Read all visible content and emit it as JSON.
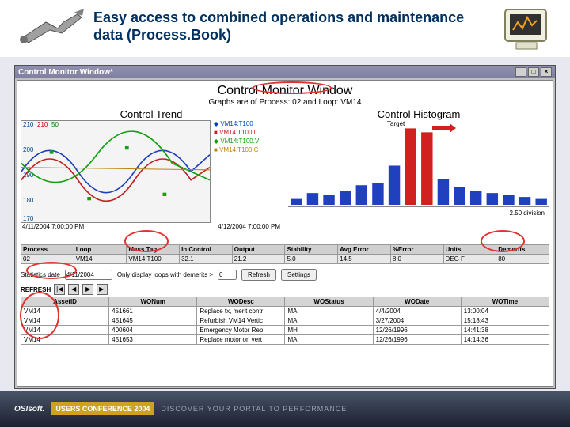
{
  "slide": {
    "title": "Easy access to combined operations and maintenance data (Process.Book)"
  },
  "window": {
    "titlebar": "Control Monitor Window*",
    "main_title": "Control Monitor Window",
    "subtitle": "Graphs are of Process: 02 and Loop: VM14",
    "trend_title": "Control Trend",
    "hist_title": "Control Histogram",
    "target_label": "Target",
    "hist_stats": "2.50 division"
  },
  "trend": {
    "x_start": "4/11/2004 7:00:00 PM",
    "x_end": "4/12/2004 7:00:00 PM",
    "legend": [
      {
        "label": "VM14:T100",
        "color": "#0040c0"
      },
      {
        "label": "VM14:T100.L",
        "color": "#c02020"
      },
      {
        "label": "VM14:T100.V",
        "color": "#10a010"
      },
      {
        "label": "VM14:T100.C",
        "color": "#c08010"
      }
    ],
    "yscale": [
      "210",
      "200",
      "190",
      "180",
      "170"
    ]
  },
  "summary_table": {
    "headers": [
      "Process",
      "Loop",
      "Mass Tag",
      "In Control",
      "Output",
      "Stability",
      "Avg Error",
      "%Error",
      "Units",
      "Demerits"
    ],
    "row": [
      "02",
      "VM14",
      "VM14:T100",
      "32.1",
      "21.2",
      "5.0",
      "14.5",
      "8.0",
      "DEG F",
      "80"
    ]
  },
  "controls": {
    "stats_label": "Statistics date",
    "stats_value": "4/11/2004",
    "only_label": "Only display loops with demerits >",
    "only_value": "0",
    "refresh": "Refresh",
    "settings": "Settings",
    "big_refresh": "REFRESH"
  },
  "wo_table": {
    "headers": [
      "AssetID",
      "WONum",
      "WODesc",
      "WOStatus",
      "WODate",
      "WOTime"
    ],
    "rows": [
      [
        "VM14",
        "451661",
        "Replace tx, merit contr",
        "MA",
        "4/4/2004",
        "13:00:04"
      ],
      [
        "VM14",
        "451645",
        "Refurbish VM14 Vertic",
        "MA",
        "3/27/2004",
        "15:18:43"
      ],
      [
        "VM14",
        "400604",
        "Emergency Motor Rep",
        "MH",
        "12/26/1996",
        "14:41:38"
      ],
      [
        "VM14",
        "451653",
        "Replace motor on vert",
        "MA",
        "12/26/1996",
        "14:14:36"
      ]
    ]
  },
  "footer": {
    "brand": "OSIsoft.",
    "badge": "USERS CONFERENCE 2004",
    "rest": "DISCOVER YOUR PORTAL TO PERFORMANCE"
  },
  "chart_data": {
    "type": "bar",
    "title": "Control Histogram",
    "x": [
      1,
      2,
      3,
      4,
      5,
      6,
      7,
      8,
      9,
      10,
      11,
      12,
      13,
      14,
      15,
      16
    ],
    "values": [
      6,
      12,
      10,
      14,
      20,
      22,
      40,
      78,
      74,
      26,
      18,
      14,
      12,
      10,
      8,
      6
    ],
    "target_index": 8,
    "colors_default": "#2040c0",
    "color_target": "#d02020",
    "ylim": [
      0,
      80
    ]
  }
}
